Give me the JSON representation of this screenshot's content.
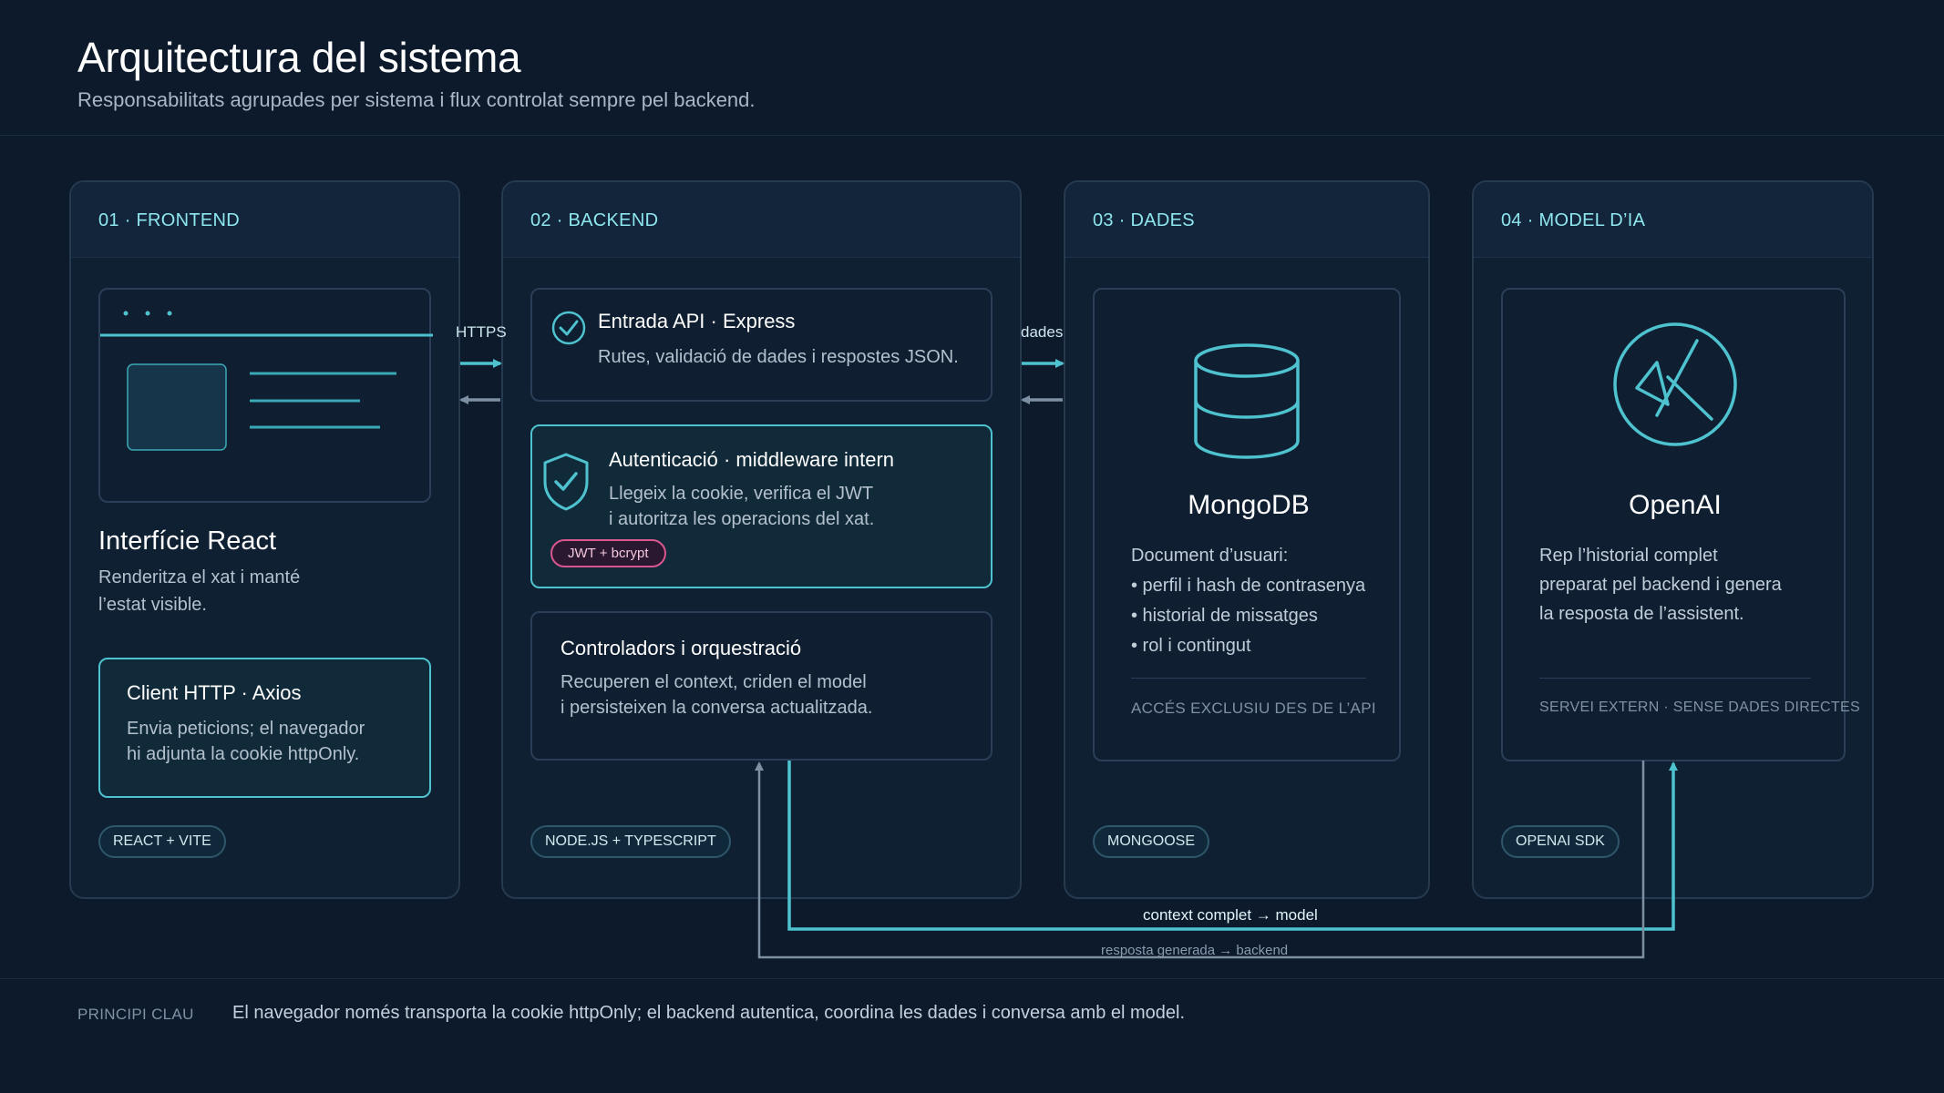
{
  "header": {
    "title": "Arquitectura del sistema",
    "subtitle": "Responsabilitats agrupades per sistema i flux controlat sempre pel backend."
  },
  "columns": {
    "frontend": {
      "title": "01 · FRONTEND",
      "app_title": "Interfície React",
      "app_desc_1": "Renderitza el xat i manté",
      "app_desc_2": "l’estat visible.",
      "http_title": "Client HTTP · Axios",
      "http_desc_1": "Envia peticions; el navegador",
      "http_desc_2": "hi adjunta la cookie httpOnly.",
      "tag": "REACT + VITE"
    },
    "backend": {
      "title": "02 · BACKEND",
      "api_title": "Entrada API · Express",
      "api_desc": "Rutes, validació de dades i respostes JSON.",
      "auth_title": "Autenticació · middleware intern",
      "auth_desc_1": "Llegeix la cookie, verifica el JWT",
      "auth_desc_2": "i autoritza les operacions del xat.",
      "auth_badge": "JWT + bcrypt",
      "ctrl_title": "Controladors i orquestració",
      "ctrl_desc_1": "Recuperen el context, criden el model",
      "ctrl_desc_2": "i persisteixen la conversa actualitzada.",
      "tag": "NODE.JS + TYPESCRIPT"
    },
    "data": {
      "title": "03 · DADES",
      "name": "MongoDB",
      "doc_label": "Document d’usuari:",
      "items": [
        "• perfil i hash de contrasenya",
        "• historial de missatges",
        "• rol i contingut"
      ],
      "note": "ACCÉS EXCLUSIU DES DE L’API",
      "tag": "MONGOOSE"
    },
    "model": {
      "title": "04 · MODEL D’IA",
      "name": "OpenAI",
      "desc_1": "Rep l’historial complet",
      "desc_2": "preparat pel backend i genera",
      "desc_3": "la resposta de l’assistent.",
      "note": "SERVEI EXTERN · SENSE DADES DIRECTES",
      "tag": "OPENAI SDK"
    }
  },
  "connectors": {
    "https": "HTTPS",
    "dades": "dades",
    "to_model": "context complet → model",
    "to_backend": "resposta generada → backend"
  },
  "footer": {
    "label": "PRINCIPI CLAU",
    "text": "El navegador només transporta la cookie httpOnly; el backend autentica, coordina les dades i conversa amb el model."
  },
  "colors": {
    "background": "#0c1a2b",
    "accent_cyan": "#4ec2cf",
    "accent_pink": "#d9568f",
    "muted_line": "#7d8fa2"
  },
  "icons": [
    "browser-window-icon",
    "check-circle-icon",
    "shield-check-icon",
    "database-icon",
    "openai-logo-icon"
  ]
}
